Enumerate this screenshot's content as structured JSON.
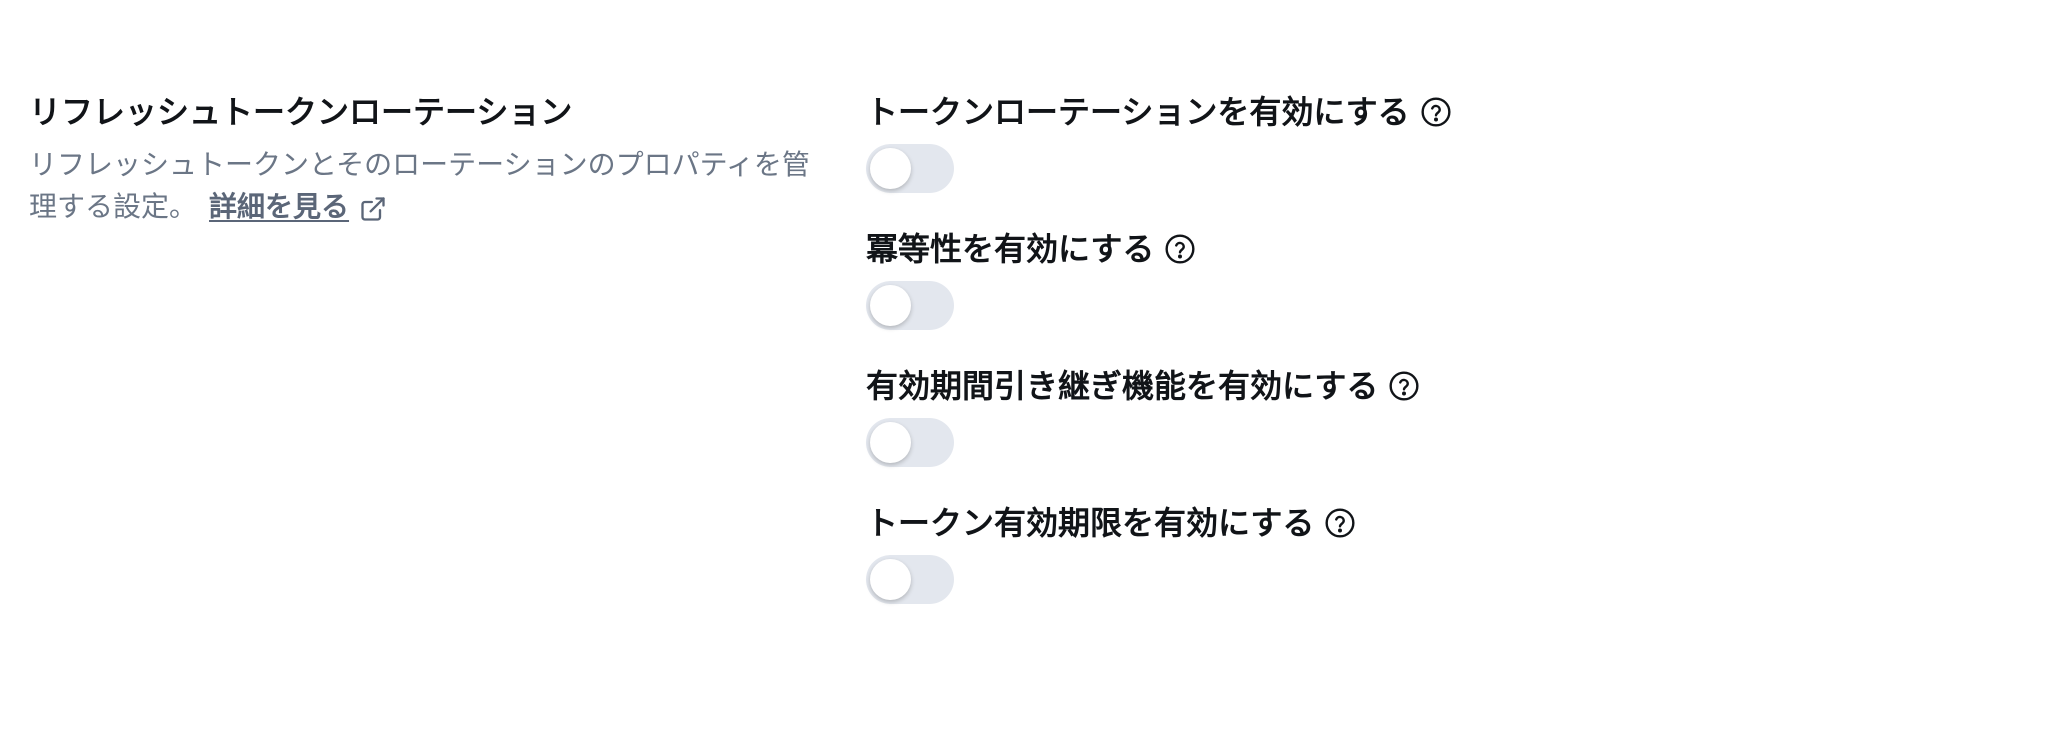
{
  "section": {
    "title": "リフレッシュトークンローテーション",
    "description": "リフレッシュトークンとそのローテーションのプロパティを管理する設定。",
    "learn_more_label": "詳細を見る",
    "learn_more_icon": "external-link-icon"
  },
  "settings": [
    {
      "label": "トークンローテーションを有効にする",
      "enabled": false,
      "help_icon": "question-circle-icon"
    },
    {
      "label": "冪等性を有効にする",
      "enabled": false,
      "help_icon": "question-circle-icon"
    },
    {
      "label": "有効期間引き継ぎ機能を有効にする",
      "enabled": false,
      "help_icon": "question-circle-icon"
    },
    {
      "label": "トークン有効期限を有効にする",
      "enabled": false,
      "help_icon": "question-circle-icon"
    }
  ],
  "colors": {
    "text_primary": "#111418",
    "text_secondary": "#6b7686",
    "toggle_off_track": "#e3e7ee",
    "toggle_knob": "#ffffff"
  }
}
